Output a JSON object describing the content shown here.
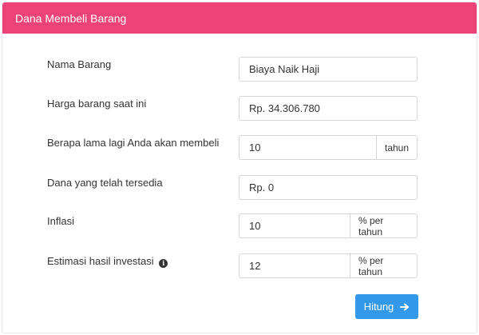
{
  "header": {
    "title": "Dana Membeli Barang"
  },
  "form": {
    "nama_barang": {
      "label": "Nama Barang",
      "value": "Biaya Naik Haji"
    },
    "harga_barang": {
      "label": "Harga barang saat ini",
      "value": "Rp. 34.306.780"
    },
    "lama_membeli": {
      "label": "Berapa lama lagi Anda akan membeli",
      "value": "10",
      "unit": "tahun"
    },
    "dana_tersedia": {
      "label": "Dana yang telah tersedia",
      "value": "Rp. 0"
    },
    "inflasi": {
      "label": "Inflasi",
      "value": "10",
      "unit": "% per tahun"
    },
    "estimasi_investasi": {
      "label": "Estimasi hasil investasi",
      "info_glyph": "i",
      "value": "12",
      "unit": "% per tahun"
    }
  },
  "actions": {
    "submit_label": "Hitung"
  },
  "colors": {
    "header_bg": "#ee4379",
    "button_bg": "#3498e8"
  },
  "icons": {
    "info": "info-icon",
    "submit": "arrow-right-icon"
  }
}
